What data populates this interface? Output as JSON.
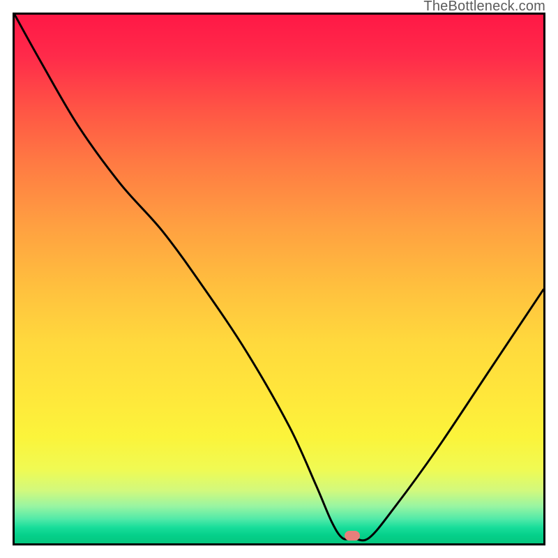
{
  "attribution": "TheBottleneck.com",
  "marker": {
    "color": "#e77f7b",
    "x_pct": 63.8,
    "y_pct": 98.6
  },
  "chart_data": {
    "type": "line",
    "title": "",
    "xlabel": "",
    "ylabel": "",
    "xlim": [
      0,
      100
    ],
    "ylim": [
      0,
      100
    ],
    "grid": false,
    "series": [
      {
        "name": "bottleneck-curve",
        "x": [
          0,
          5,
          12,
          20,
          28,
          36,
          44,
          52,
          57,
          60,
          62,
          64,
          67,
          72,
          80,
          90,
          100
        ],
        "y": [
          100,
          91,
          79,
          68,
          59,
          48,
          36,
          22,
          11,
          4,
          1,
          1,
          1,
          7,
          18,
          33,
          48
        ]
      }
    ],
    "annotations": [
      {
        "type": "marker",
        "x": 63.8,
        "y": 1.4,
        "color": "#e77f7b",
        "shape": "rounded-rect"
      }
    ]
  }
}
